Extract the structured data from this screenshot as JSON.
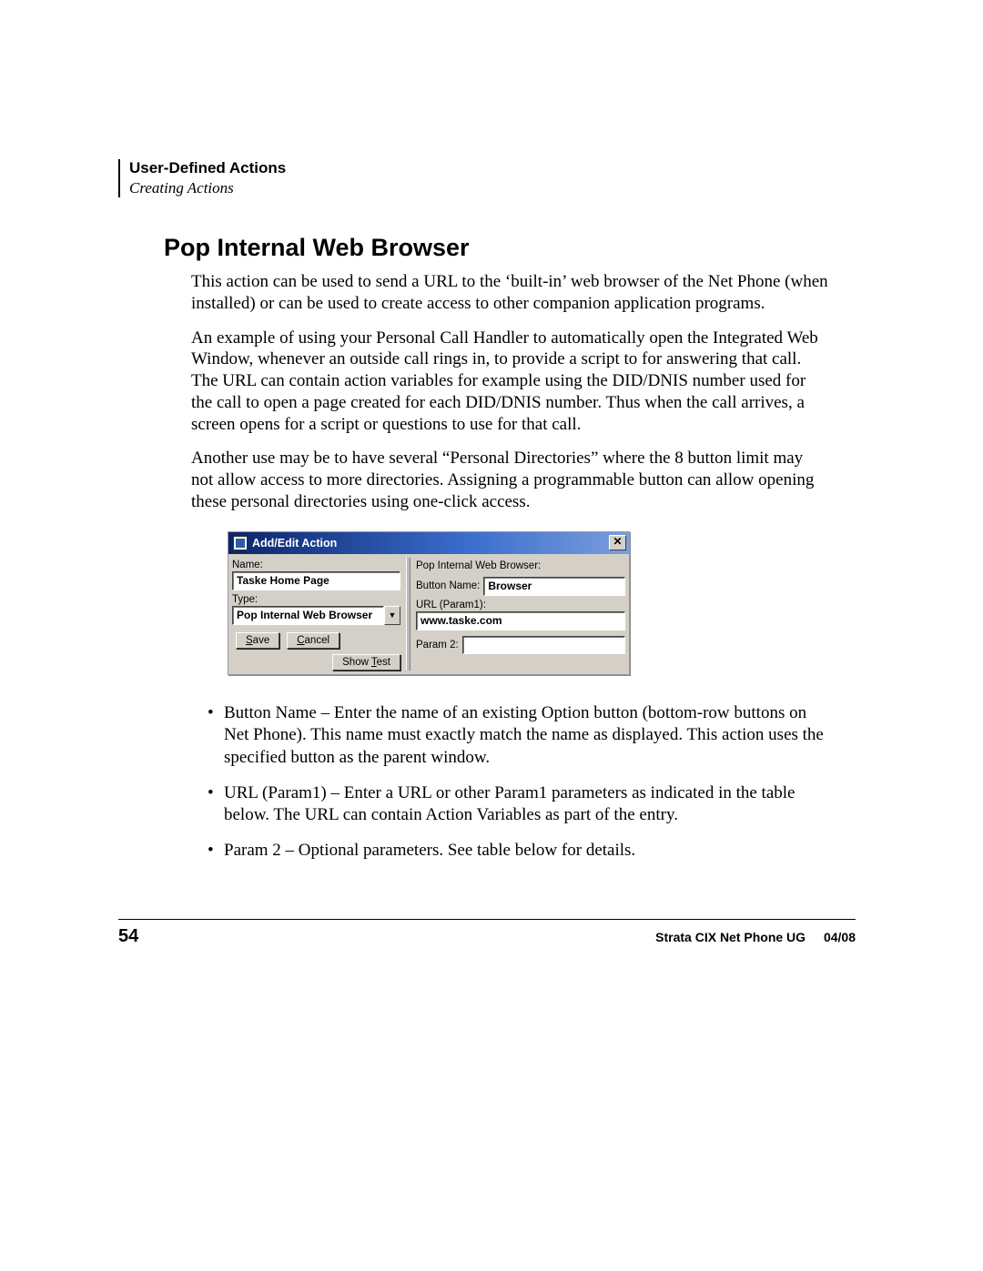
{
  "header": {
    "section": "User-Defined Actions",
    "subsection": "Creating Actions"
  },
  "title": "Pop Internal Web Browser",
  "paragraphs": {
    "p1": "This action can be used to send a URL to the ‘built-in’ web browser of the Net Phone (when installed) or can be used to create access to other companion application programs.",
    "p2": "An example of using your Personal Call Handler to automatically open the Integrated Web Window, whenever an outside call rings in, to provide a script to for answering that call.  The URL can contain action variables for example using the DID/DNIS number used for the call to open a page created for each DID/DNIS number.  Thus when the call arrives, a screen opens for a script or questions to use for that call.",
    "p3": "Another use may be to have several “Personal Directories” where the 8 button limit may not allow access to more directories.  Assigning a programmable button can allow opening these personal directories using one-click access."
  },
  "dialog": {
    "title": "Add/Edit Action",
    "left": {
      "name_label": "Name:",
      "name_value": "Taske Home Page",
      "type_label": "Type:",
      "type_value": "Pop Internal Web Browser",
      "save": "Save",
      "save_u": "S",
      "cancel": "Cancel",
      "cancel_u": "C",
      "show_test": "Show Test",
      "show_test_u": "T"
    },
    "right": {
      "header": "Pop Internal Web Browser:",
      "button_name_label": "Button Name:",
      "button_name_value": "Browser",
      "url_label": "URL (Param1):",
      "url_value": "www.taske.com",
      "param2_label": "Param 2:",
      "param2_value": ""
    }
  },
  "bullets": {
    "b1": "Button Name – Enter the name of an existing Option button (bottom-row buttons on Net Phone).  This name must exactly match the name as displayed.  This action uses the specified button as the parent window.",
    "b2": "URL (Param1) – Enter a URL or other Param1 parameters as indicated in the table below.  The URL can contain Action Variables as part of the entry.",
    "b3": "Param 2 – Optional parameters.  See table below for details."
  },
  "footer": {
    "page": "54",
    "doc": "Strata CIX Net Phone UG",
    "date": "04/08"
  }
}
